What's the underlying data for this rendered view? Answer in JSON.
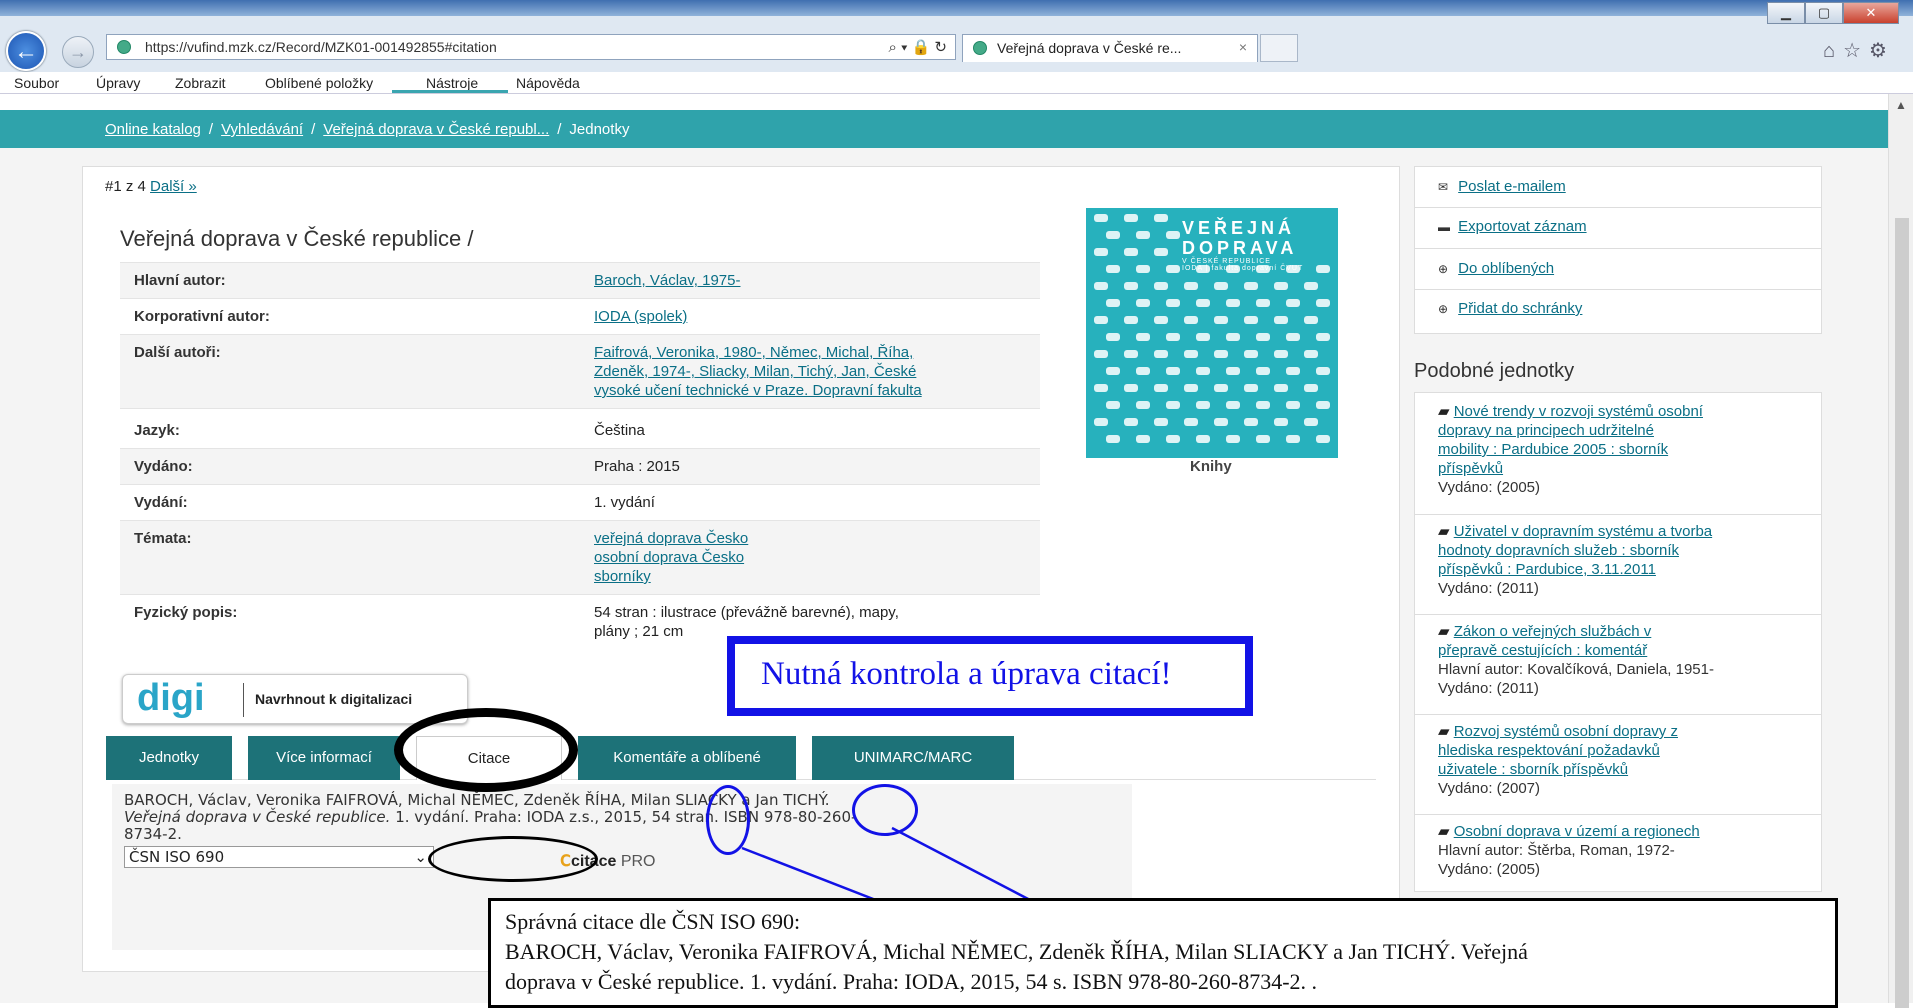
{
  "browser": {
    "url": "https://vufind.mzk.cz/Record/MZK01-001492855#citation",
    "tab_title": "Veřejná doprava v České re...",
    "tab_close": "×",
    "menu": [
      "Soubor",
      "Úpravy",
      "Zobrazit",
      "Oblíbené položky",
      "Nástroje",
      "Nápověda"
    ]
  },
  "breadcrumb": {
    "items": [
      "Online katalog",
      "Vyhledávání",
      "Veřejná doprava v České republ...",
      "Jednotky"
    ],
    "sep": "/"
  },
  "record": {
    "counter": "#1 z 4",
    "next": "Další »",
    "title": "Veřejná doprava v České republice /",
    "fields": [
      {
        "label": "Hlavní autor:",
        "value": [
          "Baroch, Václav, 1975-"
        ],
        "link": true
      },
      {
        "label": "Korporativní autor:",
        "value": [
          "IODA (spolek)"
        ],
        "link": true
      },
      {
        "label": "Další autoři:",
        "value": [
          "Faifrová, Veronika, 1980-, Němec, Michal, Říha,",
          "Zdeněk, 1974-, Sliacky, Milan, Tichý, Jan, České",
          "vysoké učení technické v Praze. Dopravní fakulta"
        ],
        "link": true
      },
      {
        "label": "Jazyk:",
        "value": [
          "Čeština"
        ],
        "link": false
      },
      {
        "label": "Vydáno:",
        "value": [
          "Praha : 2015"
        ],
        "link": false
      },
      {
        "label": "Vydání:",
        "value": [
          "1. vydání"
        ],
        "link": false
      },
      {
        "label": "Témata:",
        "value": [
          "veřejná doprava Česko",
          "osobní doprava Česko",
          "sborníky"
        ],
        "link": true
      },
      {
        "label": "Fyzický popis:",
        "value": [
          "54 stran : ilustrace (převážně barevné), mapy,",
          "plány ; 21 cm"
        ],
        "link": false
      }
    ],
    "cover": {
      "title_line1": "VEŘEJNÁ",
      "title_line2": "DOPRAVA",
      "subtitle": "V ČESKÉ REPUBLICE",
      "subtitle2": "IODA | fakulta dopravní ČVUT",
      "label": "Knihy"
    }
  },
  "digi": {
    "logo": "digi",
    "text": "Navrhnout k digitalizaci"
  },
  "tabs": [
    "Jednotky",
    "Více informací",
    "Citace",
    "Komentáře a oblíbené",
    "UNIMARC/MARC"
  ],
  "citation": {
    "line1": "BAROCH, Václav, Veronika FAIFROVÁ, Michal NĚMEC, Zdeněk ŘÍHA, Milan SLIACKY a Jan TICHÝ.",
    "line2_italic": "Veřejná doprava v České republice.",
    "line2_rest": " 1. vydání. Praha: IODA z.s., 2015, 54 stran. ISBN 978-80-260-",
    "line3": "8734-2.",
    "style_selected": "ČSN ISO 690",
    "citace_pro_main": "citace",
    "citace_pro_suffix": "PRO"
  },
  "sidebar": {
    "actions": [
      "Poslat e-mailem",
      "Exportovat záznam",
      "Do oblíbených",
      "Přidat do schránky"
    ],
    "similar_heading": "Podobné jednotky",
    "similar": [
      {
        "title": [
          "Nové trendy v rozvoji systémů osobní",
          "dopravy na principech udržitelné",
          "mobility : Pardubice 2005 : sborník",
          "příspěvků"
        ],
        "meta": [
          "Vydáno: (2005)"
        ]
      },
      {
        "title": [
          "Uživatel v dopravním systému a tvorba",
          "hodnoty dopravních služeb : sborník",
          "příspěvků : Pardubice, 3.11.2011"
        ],
        "meta": [
          "Vydáno: (2011)"
        ]
      },
      {
        "title": [
          "Zákon o veřejných službách v",
          "přepravě cestujících : komentář"
        ],
        "meta": [
          "Hlavní autor: Kovalčíková, Daniela, 1951-",
          "Vydáno: (2011)"
        ]
      },
      {
        "title": [
          "Rozvoj systémů osobní dopravy z",
          "hlediska respektování požadavků",
          "uživatele : sborník příspěvků"
        ],
        "meta": [
          "Vydáno: (2007)"
        ]
      },
      {
        "title": [
          "Osobní doprava v území a regionech"
        ],
        "meta": [
          "Hlavní autor: Štěrba, Roman, 1972-",
          "Vydáno: (2005)"
        ]
      }
    ]
  },
  "annotations": {
    "warning": "Nutná kontrola a úprava citací!",
    "correct_heading": "Správná citace dle ČSN ISO 690:",
    "correct_line1": "BAROCH, Václav, Veronika FAIFROVÁ, Michal NĚMEC, Zdeněk ŘÍHA, Milan SLIACKY a Jan TICHÝ. Veřejná",
    "correct_line2": "doprava v České republice. 1. vydání. Praha: IODA, 2015, 54 s. ISBN 978-80-260-8734-2. ."
  },
  "colors": {
    "teal": "#2fa3ab",
    "tab_dark": "#1d7278",
    "link": "#0a6f86",
    "annotation_blue": "#1212e6"
  }
}
